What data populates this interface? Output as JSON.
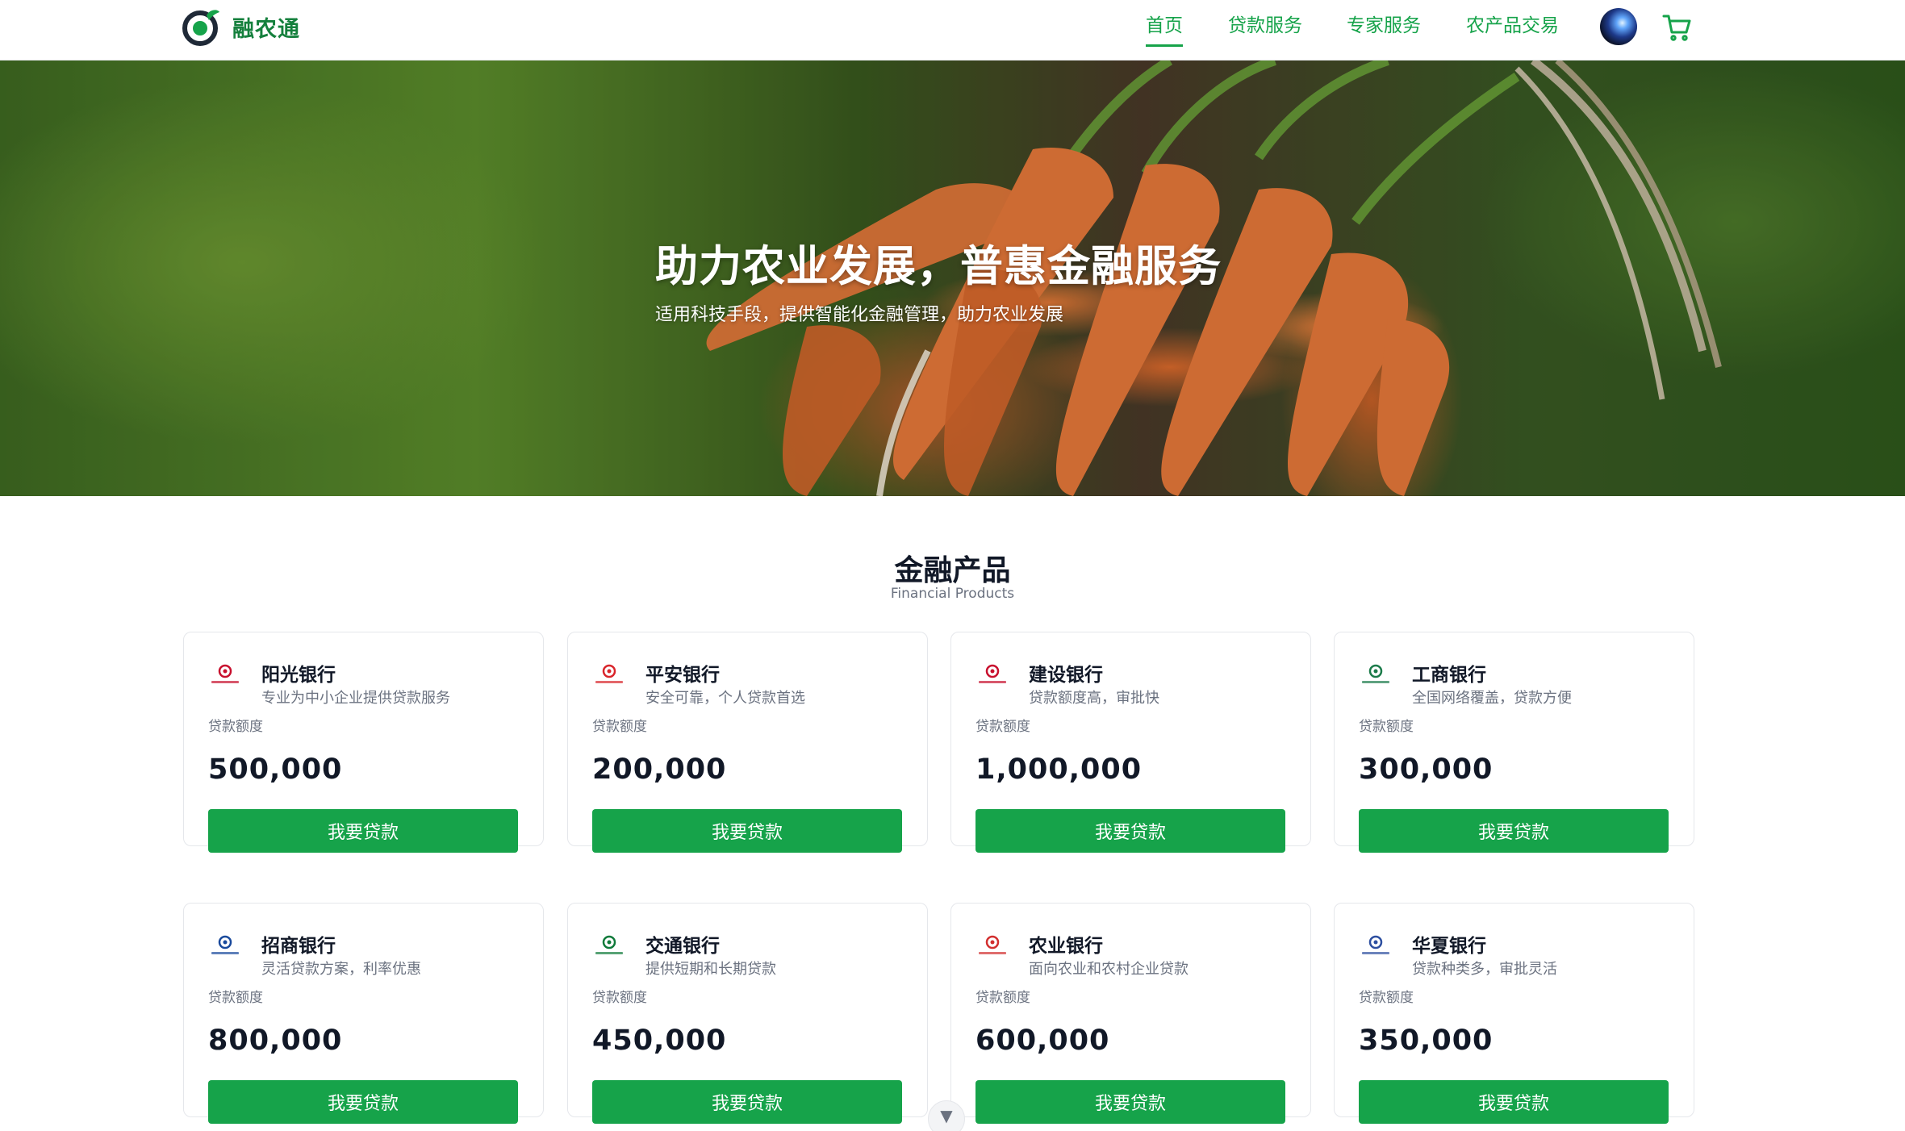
{
  "header": {
    "brand": "融农通",
    "nav": [
      {
        "label": "首页",
        "active": true
      },
      {
        "label": "贷款服务",
        "active": false
      },
      {
        "label": "专家服务",
        "active": false
      },
      {
        "label": "农产品交易",
        "active": false
      }
    ],
    "icons": {
      "cart": "cart-icon",
      "avatar": "user-avatar"
    },
    "accent_color": "#16a34a"
  },
  "hero": {
    "title": "助力农业发展，普惠金融服务",
    "subtitle": "适用科技手段，提供智能化金融管理，助力农业发展"
  },
  "products": {
    "title": "金融产品",
    "subtitle": "Financial Products",
    "amount_label": "贷款额度",
    "button_label": "我要贷款",
    "items": [
      {
        "name": "阳光银行",
        "desc": "专业为中小企业提供贷款服务",
        "amount": "500,000",
        "logo_color": "#c8102e"
      },
      {
        "name": "平安银行",
        "desc": "安全可靠，个人贷款首选",
        "amount": "200,000",
        "logo_color": "#d9252b"
      },
      {
        "name": "建设银行",
        "desc": "贷款额度高，审批快",
        "amount": "1,000,000",
        "logo_color": "#c8102e"
      },
      {
        "name": "工商银行",
        "desc": "全国网络覆盖，贷款方便",
        "amount": "300,000",
        "logo_color": "#1b7b4a"
      },
      {
        "name": "招商银行",
        "desc": "灵活贷款方案，利率优惠",
        "amount": "800,000",
        "logo_color": "#1a4a9c"
      },
      {
        "name": "交通银行",
        "desc": "提供短期和长期贷款",
        "amount": "450,000",
        "logo_color": "#0f7a3a"
      },
      {
        "name": "农业银行",
        "desc": "面向农业和农村企业贷款",
        "amount": "600,000",
        "logo_color": "#d22f2f"
      },
      {
        "name": "华夏银行",
        "desc": "贷款种类多，审批灵活",
        "amount": "350,000",
        "logo_color": "#2d4fa0"
      }
    ]
  },
  "scroll_indicator": "chevron-down-icon"
}
